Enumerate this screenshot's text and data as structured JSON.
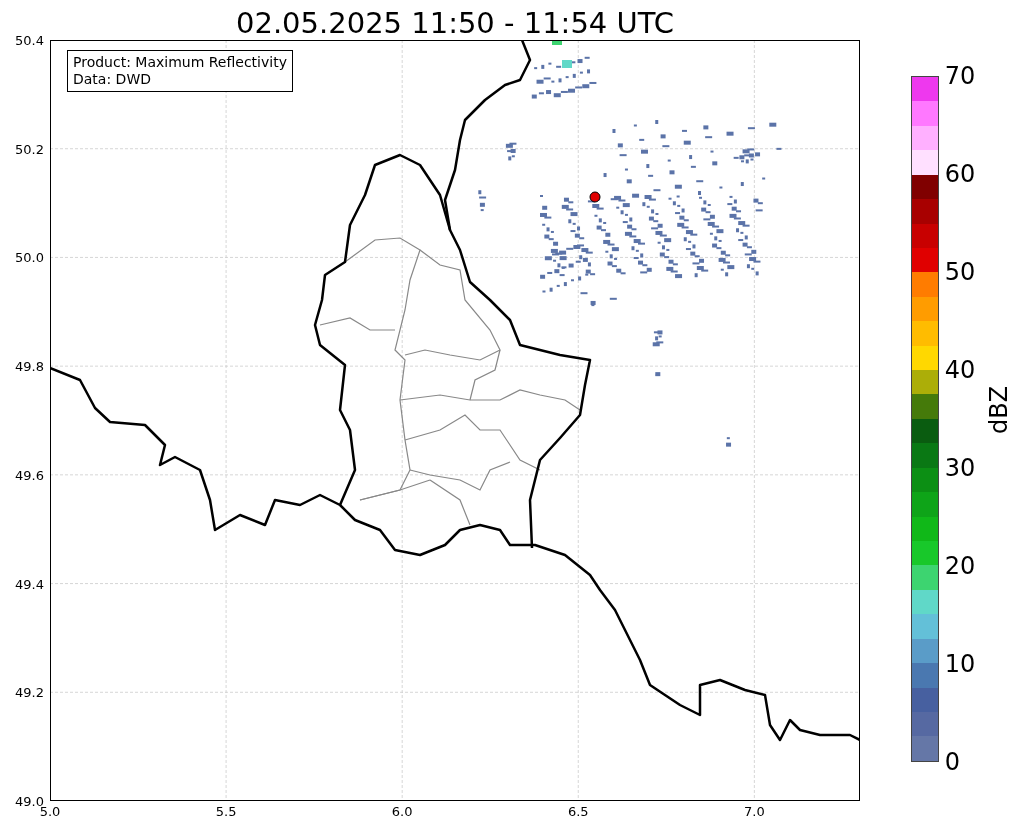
{
  "title": "02.05.2025 11:50 - 11:54 UTC",
  "map": {
    "legend": [
      "Product: Maximum Reflectivity",
      "Data: DWD"
    ],
    "yticks": [
      "50.4",
      "50.2",
      "50.0",
      "49.8",
      "49.6",
      "49.4",
      "49.2",
      "49.0"
    ],
    "xticks": [
      "5.0",
      "5.5",
      "6.0",
      "6.5",
      "7.0"
    ]
  },
  "colorbar": {
    "label": "dBZ",
    "ticks": [
      "70",
      "60",
      "50",
      "40",
      "30",
      "20",
      "10",
      "0"
    ],
    "bands": [
      {
        "color": "#ee38ee"
      },
      {
        "color": "#ff78ff"
      },
      {
        "color": "#ffb0ff"
      },
      {
        "color": "#ffe0ff"
      },
      {
        "color": "#800000"
      },
      {
        "color": "#a80000"
      },
      {
        "color": "#c80000"
      },
      {
        "color": "#e00000"
      },
      {
        "color": "#ff7c00"
      },
      {
        "color": "#ff9c00"
      },
      {
        "color": "#ffbc00"
      },
      {
        "color": "#ffd800"
      },
      {
        "color": "#acae08"
      },
      {
        "color": "#457a0a"
      },
      {
        "color": "#0a5c10"
      },
      {
        "color": "#0a7814"
      },
      {
        "color": "#0c8f14"
      },
      {
        "color": "#0ea418"
      },
      {
        "color": "#10b818"
      },
      {
        "color": "#18c82a"
      },
      {
        "color": "#3dd470"
      },
      {
        "color": "#60d8c8"
      },
      {
        "color": "#63c0d8"
      },
      {
        "color": "#5a9cc8"
      },
      {
        "color": "#4a78b0"
      },
      {
        "color": "#4760a0"
      },
      {
        "color": "#5669a2"
      },
      {
        "color": "#6577a7"
      }
    ]
  }
}
